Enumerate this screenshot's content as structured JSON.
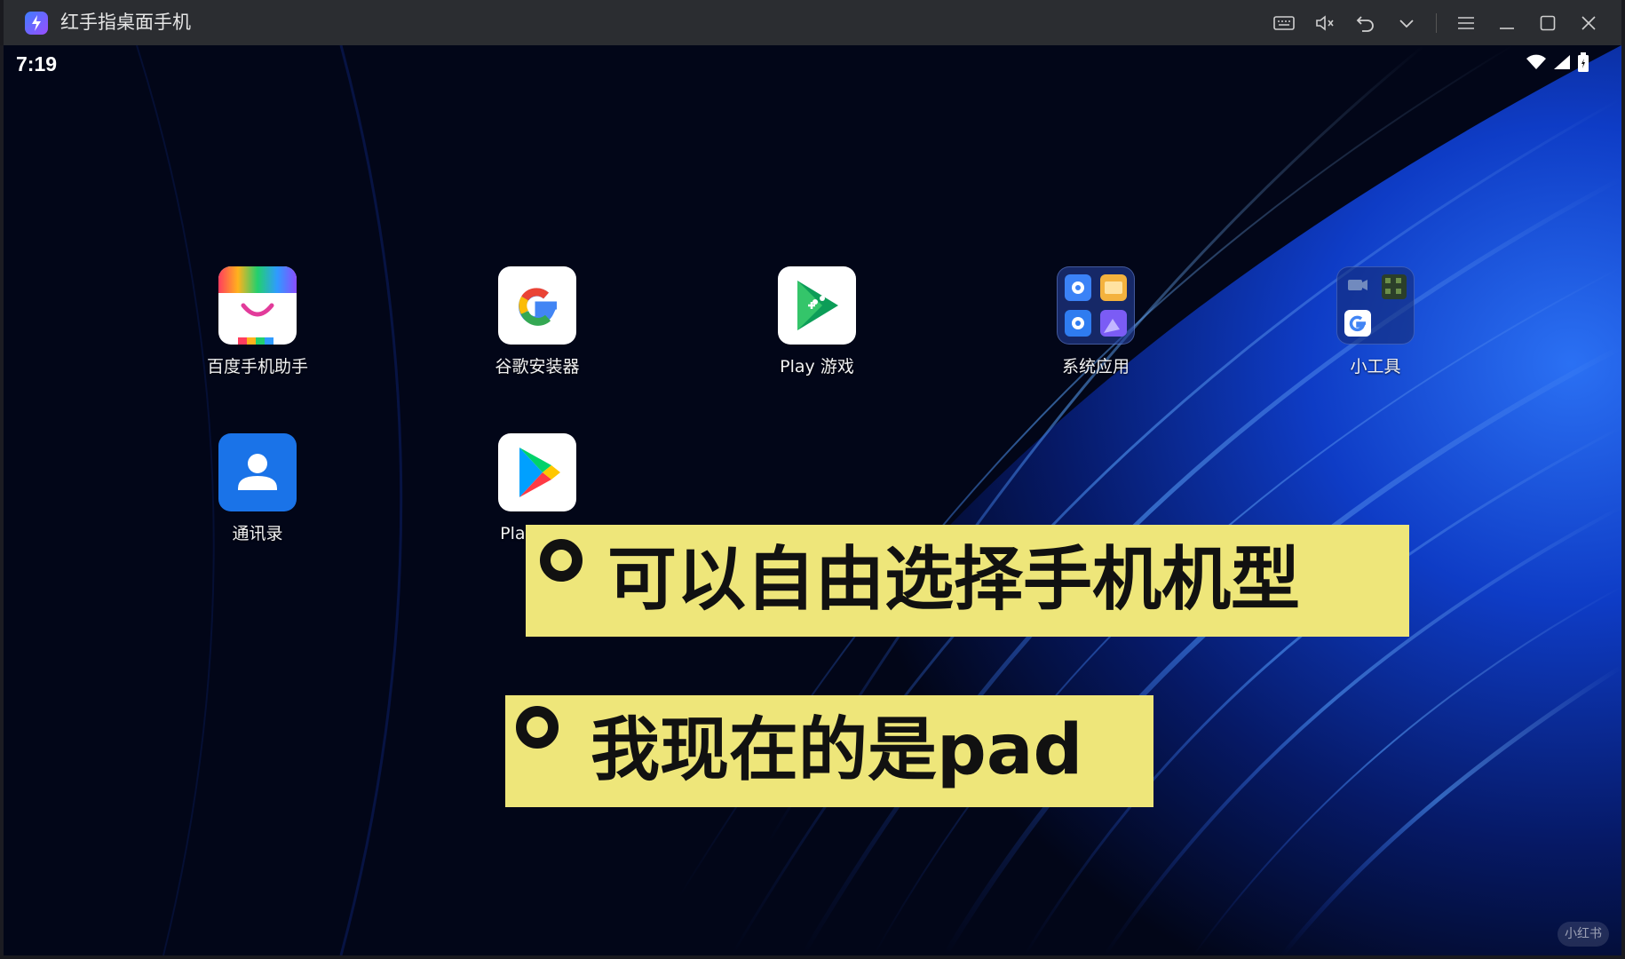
{
  "window": {
    "title": "红手指桌面手机"
  },
  "titlebar_icons": [
    "keyboard-icon",
    "mute-icon",
    "undo-icon",
    "chevron-down-icon",
    "menu-icon",
    "minimize-icon",
    "maximize-icon",
    "close-icon"
  ],
  "status_bar": {
    "time": "7:19"
  },
  "apps": [
    {
      "label": "百度手机助手",
      "icon": "baidu-assistant-icon"
    },
    {
      "label": "谷歌安装器",
      "icon": "google-installer-icon"
    },
    {
      "label": "Play 游戏",
      "icon": "play-games-icon"
    },
    {
      "label": "系统应用",
      "icon": "system-apps-folder-icon"
    },
    {
      "label": "小工具",
      "icon": "tools-folder-icon"
    },
    {
      "label": "通讯录",
      "icon": "contacts-icon"
    },
    {
      "label": "Play 商店",
      "icon": "play-store-icon"
    }
  ],
  "captions": [
    {
      "text": "可以自由选择手机机型"
    },
    {
      "text": "我现在的是pad"
    }
  ],
  "watermark": "小红书",
  "colors": {
    "caption_bg": "#eee67a",
    "titlebar_bg": "#2b2d31",
    "wallpaper_accent": "#1e5bff"
  }
}
